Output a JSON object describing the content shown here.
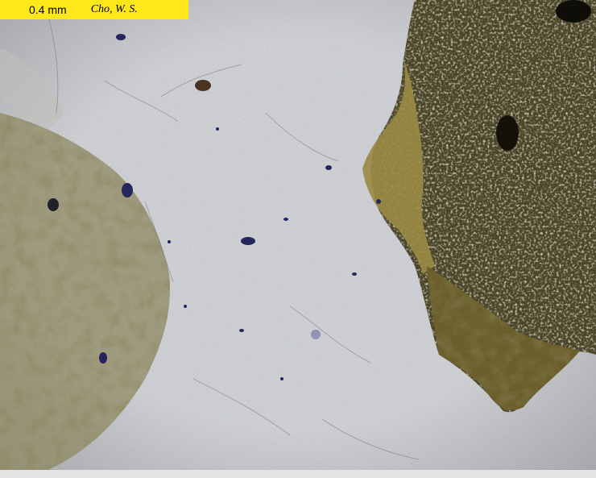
{
  "caption": {
    "scale_label": "0.4 mm",
    "credit": "Cho, W. S."
  },
  "colors": {
    "label_background": "#ffe81a",
    "matrix": "#d8dadc",
    "mineral_olive": "#8a7a3a",
    "mineral_dark": "#3a3520",
    "inclusion_blue": "#2a2a80",
    "bottom_strip": "#e4e4e4"
  }
}
